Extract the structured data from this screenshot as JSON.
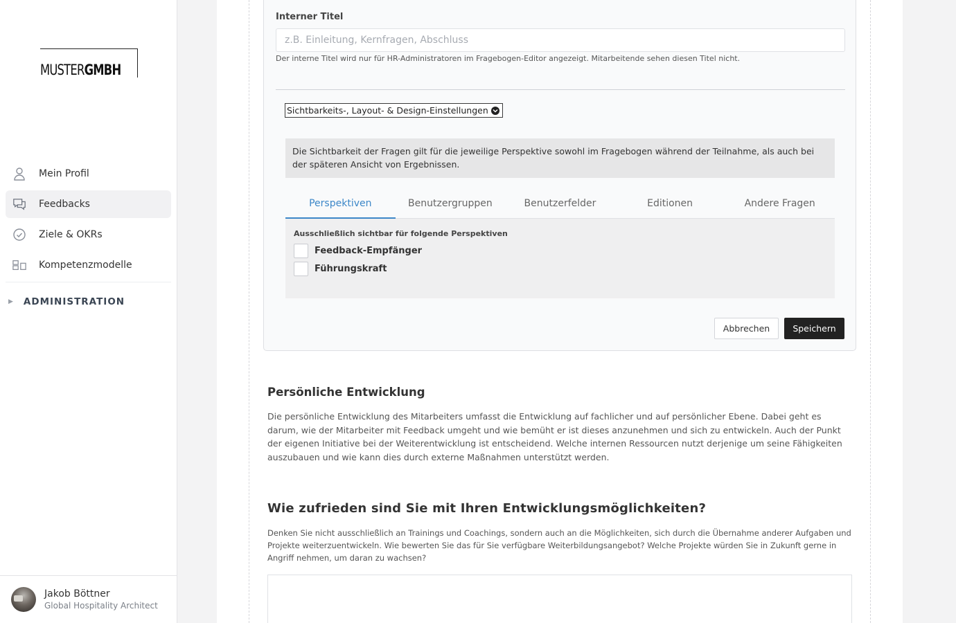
{
  "brand": {
    "logo_light": "MUSTER",
    "logo_bold": "GMBH"
  },
  "sidebar": {
    "items": [
      {
        "label": "Mein Profil",
        "icon": "user-icon",
        "active": false
      },
      {
        "label": "Feedbacks",
        "icon": "chat-bubbles-icon",
        "active": true
      },
      {
        "label": "Ziele & OKRs",
        "icon": "check-circle-icon",
        "active": false
      },
      {
        "label": "Kompetenzmodelle",
        "icon": "grid-icon",
        "active": false
      }
    ],
    "admin_label": "ADMINISTRATION",
    "admin_caret": "▶"
  },
  "user": {
    "name": "Jakob Böttner",
    "role": "Global Hospitality Architect"
  },
  "card": {
    "title_label": "Interner Titel",
    "title_placeholder": "z.B. Einleitung, Kernfragen, Abschluss",
    "title_value": "",
    "hint": "Der interne Titel wird nur für HR-Administratoren im Fragebogen-Editor angezeigt. Mitarbeitende sehen diesen Titel nicht.",
    "settings_toggle": "Sichtbarkeits-, Layout- & Design-Einstellungen",
    "info_text": "Die Sichtbarkeit der Fragen gilt für die jeweilige Perspektive sowohl im Fragebogen während der Teilnahme, als auch bei der späteren Ansicht von Ergebnissen.",
    "tabs": [
      {
        "label": "Perspektiven",
        "active": true
      },
      {
        "label": "Benutzergruppen",
        "active": false
      },
      {
        "label": "Benutzerfelder",
        "active": false
      },
      {
        "label": "Editionen",
        "active": false
      },
      {
        "label": "Andere Fragen",
        "active": false
      }
    ],
    "panel_label": "Ausschließlich sichtbar für folgende Perspektiven",
    "checkboxes": [
      {
        "label": "Feedback-Empfänger",
        "checked": false
      },
      {
        "label": "Führungskraft",
        "checked": false
      }
    ],
    "cancel_label": "Abbrechen",
    "save_label": "Speichern"
  },
  "section": {
    "title": "Persönliche Entwicklung",
    "description": "Die persönliche Entwicklung des Mitarbeiters umfasst die Entwicklung auf fachlicher und auf persönlicher Ebene. Dabei geht es darum, wie der Mitarbeiter mit Feedback umgeht und wie bemüht er ist dieses anzunehmen und sich zu entwickeln. Auch der Punkt der eigenen Initiative bei der Weiterentwicklung ist entscheidend. Welche internen Ressourcen nutzt derjenige um seine Fähigkeiten auszubauen und wie kann dies durch externe Maßnahmen unterstützt werden."
  },
  "question": {
    "title": "Wie zufrieden sind Sie mit Ihren Entwicklungsmöglichkeiten?",
    "description": "Denken Sie nicht ausschließlich an Trainings und Coachings, sondern auch an die Möglichkeiten, sich durch die Übernahme anderer Aufgaben und Projekte weiterzuentwickeln. Wie bewerten Sie das für Sie verfügbare Weiterbildungsangebot? Welche Projekte würden Sie in Zukunft gerne in Angriff nehmen, um daran zu wachsen?"
  },
  "colors": {
    "accent": "#3c87c8",
    "primary_button": "#222222",
    "info_bg": "#e6e6e7"
  }
}
